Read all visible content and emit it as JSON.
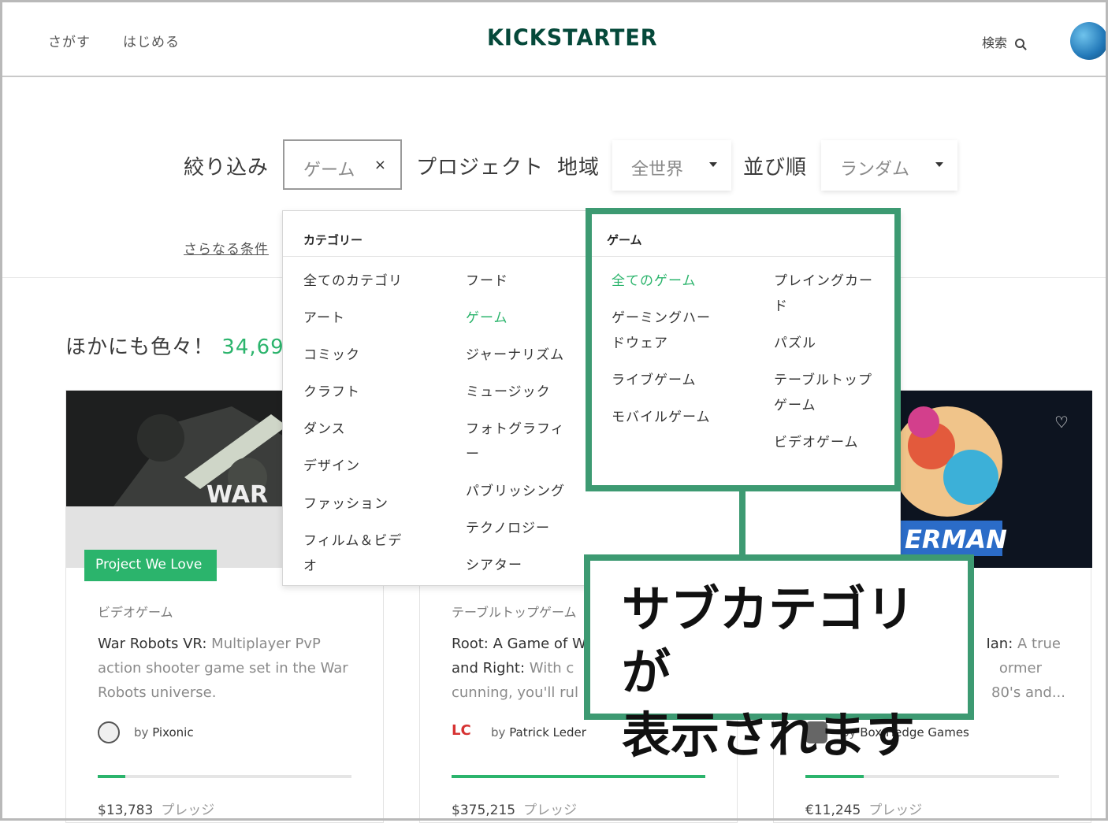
{
  "header": {
    "nav_explore": "さがす",
    "nav_start": "はじめる",
    "logo": "KICKSTARTER",
    "search_label": "検索"
  },
  "filter": {
    "prefix": "絞り込み",
    "category_value": "ゲーム",
    "clear_symbol": "×",
    "project_label": "プロジェクト",
    "location_label": "地域",
    "location_value": "全世界",
    "sort_label": "並び順",
    "sort_value": "ランダム",
    "more_conditions": "さらなる条件"
  },
  "heading": {
    "text": "ほかにも色々！",
    "count": "34,69"
  },
  "dropdown": {
    "left_header": "カテゴリー",
    "right_header": "ゲーム",
    "categories_col1": [
      "全てのカテゴリ",
      "アート",
      "コミック",
      "クラフト",
      "ダンス",
      "デザイン",
      "ファッション",
      "フィルム＆ビデ",
      "オ"
    ],
    "categories_col2": [
      "フード",
      "ゲーム",
      "ジャーナリズム",
      "ミュージック",
      "フォトグラフィ",
      "ー",
      "パブリッシング",
      "テクノロジー",
      "シアター"
    ],
    "sub_col1": [
      "全てのゲーム",
      "ゲーミングハー",
      "ドウェア",
      "ライブゲーム",
      "モバイルゲーム"
    ],
    "sub_col2": [
      "プレイングカー",
      "ド",
      "パズル",
      "テーブルトップ",
      "ゲーム",
      "ビデオゲーム"
    ]
  },
  "callout": {
    "line1": "サブカテゴリが",
    "line2": "表示されます"
  },
  "cards": [
    {
      "badge": "Project We Love",
      "category": "ビデオゲーム",
      "title": "War Robots VR:",
      "description": "Multiplayer PvP action shooter game set in the War Robots universe.",
      "image_text": "WAR",
      "creator_prefix": "by",
      "creator": "Pixonic",
      "progress": 0.11,
      "amount": "$13,783",
      "pledge_label": "プレッジ"
    },
    {
      "category": "テーブルトップゲーム",
      "title_line1": "Root: A Game of W",
      "title_line2": "and Right:",
      "description_line2": "With c",
      "description_line3": "cunning, you'll rul",
      "creator_prefix": "by",
      "creator": "Patrick Leder",
      "progress": 1.0,
      "amount": "$375,215",
      "pledge_label": "プレッジ"
    },
    {
      "title_tail": "Ian:",
      "description_line1": "A true",
      "description_line2": "ormer",
      "description_line3": "80's and...",
      "image_text": "ERMAN",
      "creator_prefix": "by",
      "creator": "Box Hedge Games",
      "progress": 0.23,
      "amount": "€11,245",
      "pledge_label": "プレッジ"
    }
  ],
  "colors": {
    "accent_green": "#2bb46c",
    "annotation_green": "#3d9a72",
    "logo_green": "#05493a"
  }
}
